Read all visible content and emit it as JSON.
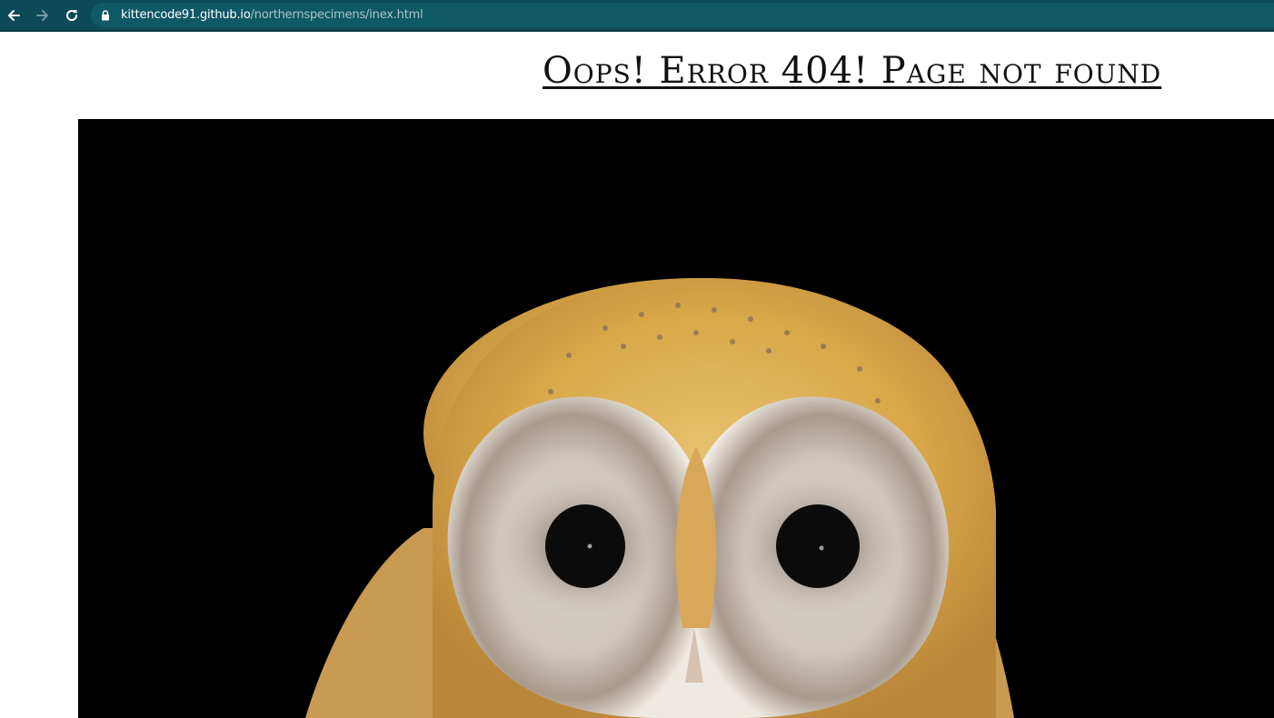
{
  "browser": {
    "url_host": "kittencode91.github.io",
    "url_path": "/northernspecimens/inex.html",
    "icons": {
      "back": "arrow-left-icon",
      "forward": "arrow-right-icon",
      "reload": "reload-icon",
      "lock": "lock-icon"
    },
    "colors": {
      "toolbar": "#0c4a57",
      "omnibox": "#0f5866"
    }
  },
  "page": {
    "title": "Oops! Error 404! Page not found",
    "image": {
      "subject": "owl-photo",
      "background_color": "#000000"
    }
  }
}
